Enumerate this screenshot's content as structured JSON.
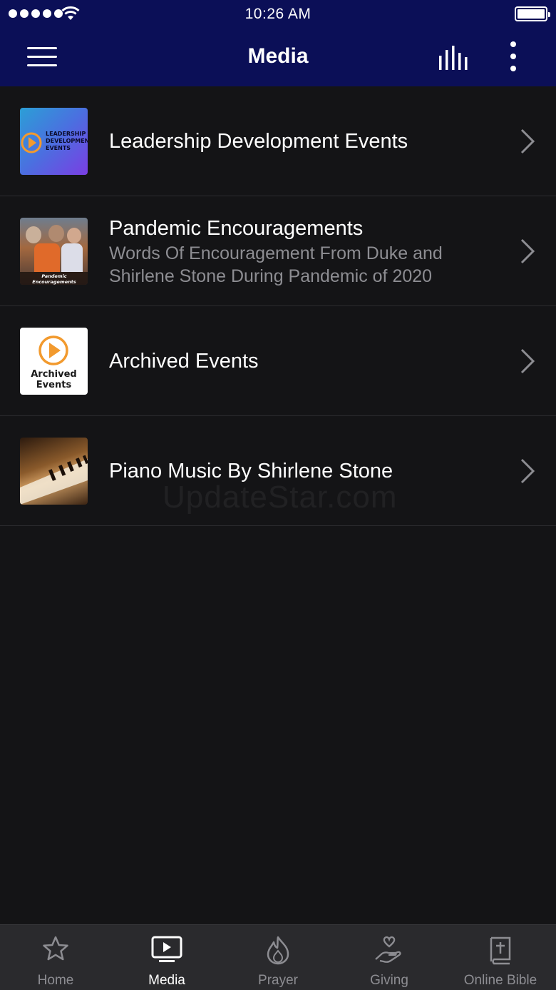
{
  "status_bar": {
    "time": "10:26 AM"
  },
  "header": {
    "title": "Media"
  },
  "media_items": [
    {
      "title": "Leadership Development Events",
      "subtitle": "",
      "thumb_text": "LEADERSHIP DEVELOPMENT EVENTS"
    },
    {
      "title": "Pandemic Encouragements",
      "subtitle": "Words Of Encouragement From Duke and Shirlene Stone During Pandemic of 2020",
      "thumb_text": "Pandemic Encouragements"
    },
    {
      "title": "Archived Events",
      "subtitle": "",
      "thumb_text": "Archived Events"
    },
    {
      "title": "Piano Music By Shirlene Stone",
      "subtitle": "",
      "thumb_text": ""
    }
  ],
  "watermark": "UpdateStar.com",
  "tabs": [
    {
      "label": "Home",
      "icon": "star-icon",
      "active": false
    },
    {
      "label": "Media",
      "icon": "tv-play-icon",
      "active": true
    },
    {
      "label": "Prayer",
      "icon": "flame-icon",
      "active": false
    },
    {
      "label": "Giving",
      "icon": "hand-heart-icon",
      "active": false
    },
    {
      "label": "Online Bible",
      "icon": "bible-icon",
      "active": false
    }
  ],
  "colors": {
    "header_bg": "#0b0f57",
    "page_bg": "#141416",
    "tabbar_bg": "#2a2a2d",
    "muted_text": "#8d8d92"
  }
}
